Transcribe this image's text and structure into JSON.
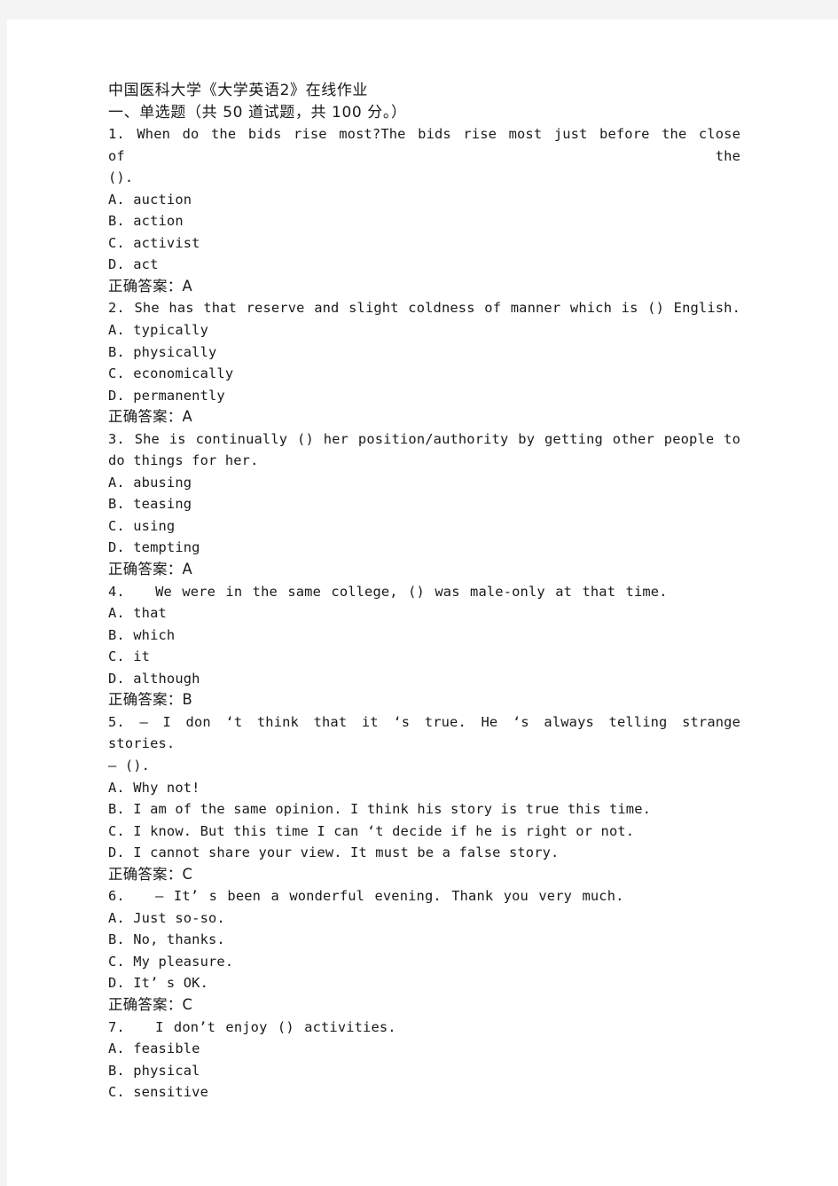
{
  "document": {
    "title": "中国医科大学《大学英语2》在线作业",
    "section_heading": "一、单选题（共 50 道试题，共 100 分。）",
    "answer_label": "正确答案：",
    "questions": [
      {
        "number": "1.",
        "stem_line1": "When do the bids rise  most?The bids rise most  just before the close of  the",
        "stem_line2": "().",
        "options": [
          "A. auction",
          "B. action",
          "C. activist",
          "D. act"
        ],
        "answer": "A"
      },
      {
        "number": "2.",
        "stem_line1": "She has that reserve and slight coldness of manner which is () English.",
        "stem_line2": "",
        "options": [
          "A. typically",
          "B. physically",
          "C. economically",
          "D. permanently"
        ],
        "answer": "A"
      },
      {
        "number": "3.",
        "stem_line1": "She is continually () her position/authority by getting other people to",
        "stem_line2": "do things for her.",
        "options": [
          "A. abusing",
          "B. teasing",
          "C. using",
          "D. tempting"
        ],
        "answer": "A"
      },
      {
        "number": "4.",
        "stem_line1": "We were in the same college, () was male-only at that time.",
        "stem_line2": "",
        "options": [
          "A. that",
          "B. which",
          "C. it",
          "D. although"
        ],
        "answer": "B"
      },
      {
        "number": "5.",
        "stem_line1": "— I don ‘t think that it ‘s true. He ‘s always telling strange stories.",
        "stem_line2": "— ().",
        "options": [
          "A. Why not!",
          "B. I am of the same opinion. I think his story is true this time.",
          "C. I know. But this time I can ‘t decide if he is right or not.",
          "D. I cannot share your view. It must be a false story."
        ],
        "answer": "C"
      },
      {
        "number": "6.",
        "stem_line1": "— It’ s been a wonderful evening. Thank you very much.",
        "stem_line2": "",
        "options": [
          "A. Just so-so.",
          "B. No, thanks.",
          "C. My pleasure.",
          "D. It’ s OK."
        ],
        "answer": "C"
      },
      {
        "number": "7.",
        "stem_line1": "I don’t enjoy () activities.",
        "stem_line2": "",
        "options": [
          "A. feasible",
          "B. physical",
          "C. sensitive"
        ],
        "answer": ""
      }
    ]
  },
  "lines": {
    "q1_stem1": "1.   When do the bids rise  most?The bids rise most  just before the close of  the",
    "q1_stem2": "().",
    "q1_a": "A. auction",
    "q1_b": "B. action",
    "q1_c": "C. activist",
    "q1_d": "D. act",
    "q1_ans": "正确答案：A",
    "q2_stem1": "2.   She has that reserve and slight coldness of manner which is () English.",
    "q2_a": "A. typically",
    "q2_b": "B. physically",
    "q2_c": "C. economically",
    "q2_d": "D. permanently",
    "q2_ans": "正确答案：A",
    "q3_stem1": "3.   She is continually () her position/authority by getting other people to",
    "q3_stem2": "do things for her.",
    "q3_a": "A. abusing",
    "q3_b": "B. teasing",
    "q3_c": "C. using",
    "q3_d": "D. tempting",
    "q3_ans": "正确答案：A",
    "q4_stem1": "4.   We were in the same college, () was male-only at that time.",
    "q4_a": "A. that",
    "q4_b": "B. which",
    "q4_c": "C. it",
    "q4_d": "D. although",
    "q4_ans": "正确答案：B",
    "q5_stem1": "5.   — I don ‘t think that it ‘s true. He ‘s always telling strange stories.",
    "q5_stem2": "— ().",
    "q5_a": "A. Why not!",
    "q5_b": "B. I am of the same opinion. I think his story is true this time.",
    "q5_c": "C. I know. But this time I can ‘t decide if he is right or not.",
    "q5_d": "D. I cannot share your view. It must be a false story.",
    "q5_ans": "正确答案：C",
    "q6_stem1": "6.   — It’ s been a wonderful evening. Thank you very much.",
    "q6_a": "A. Just so-so.",
    "q6_b": "B. No, thanks.",
    "q6_c": "C. My pleasure.",
    "q6_d": "D. It’ s OK.",
    "q6_ans": "正确答案：C",
    "q7_stem1": "7.   I don’t enjoy () activities.",
    "q7_a": "A. feasible",
    "q7_b": "B. physical",
    "q7_c": "C. sensitive"
  }
}
